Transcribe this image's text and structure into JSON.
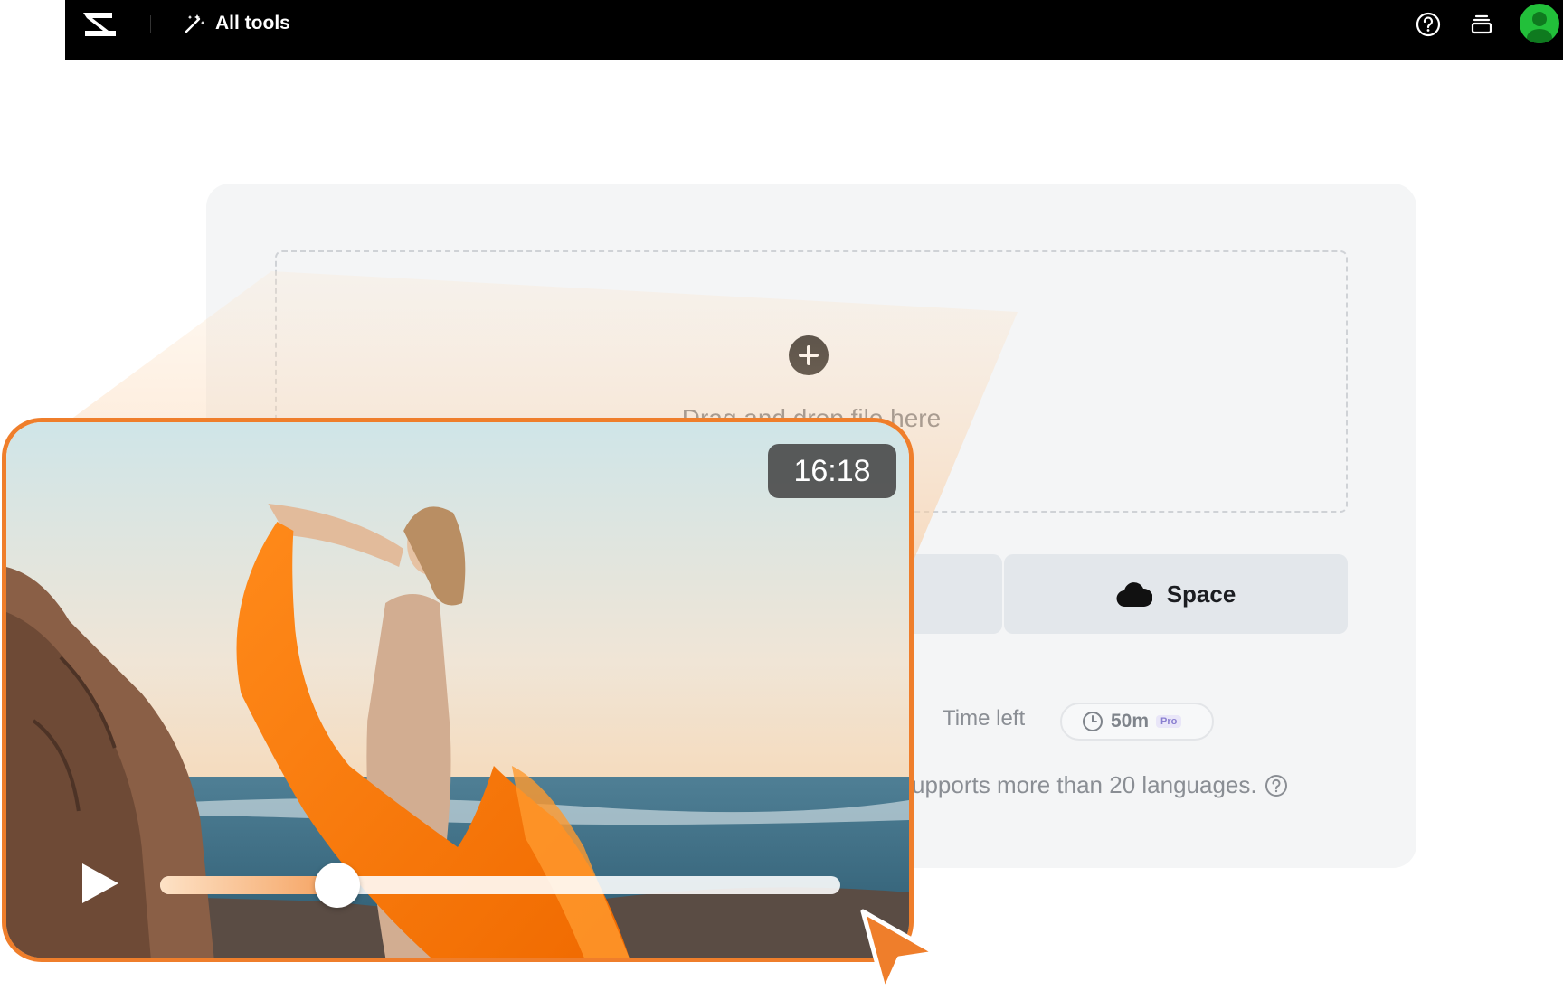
{
  "topbar": {
    "all_tools_label": "All tools",
    "icons": [
      "capcut-logo-icon",
      "magic-wand-icon",
      "help-icon",
      "layers-icon",
      "avatar-icon"
    ]
  },
  "upload": {
    "drop_text": "Drag and drop file here",
    "space_label": "Space",
    "time_left_label": "Time left",
    "time_left_value": "50m",
    "plan_badge": "Pro",
    "languages_text": "upports more than 20 languages."
  },
  "video": {
    "timestamp": "16:18",
    "progress": 0.26
  },
  "colors": {
    "accent": "#ef7e2b",
    "topbar": "#000000",
    "card": "#f4f5f6",
    "avatar": "#22c03a"
  }
}
